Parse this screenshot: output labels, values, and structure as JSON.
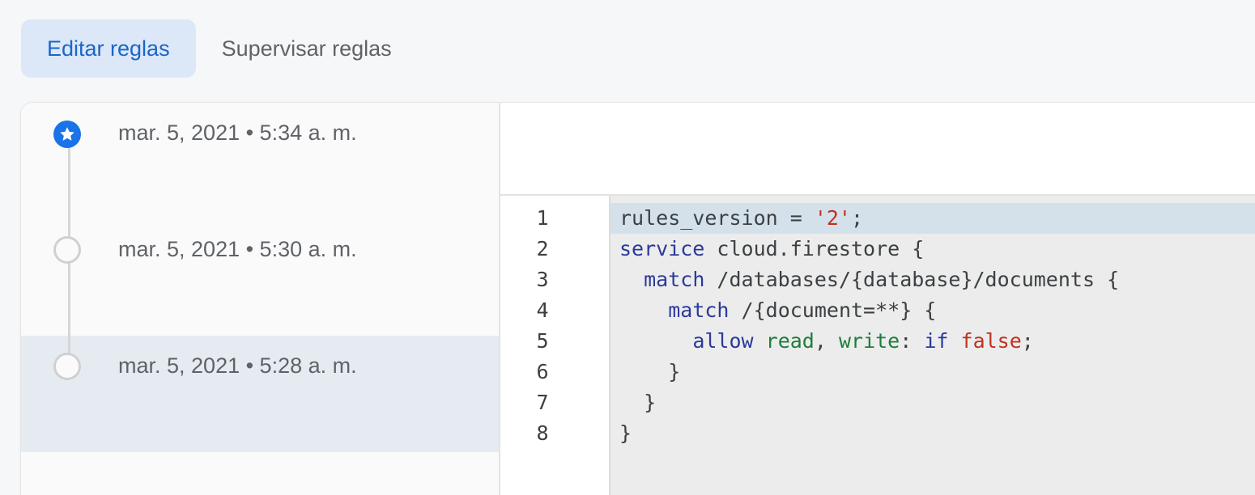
{
  "tabs": [
    {
      "label": "Editar reglas",
      "active": true
    },
    {
      "label": "Supervisar reglas",
      "active": false
    }
  ],
  "history": {
    "items": [
      {
        "timestamp": "mar. 5, 2021 • 5:34 a. m.",
        "status": "published",
        "selected": false
      },
      {
        "timestamp": "mar. 5, 2021 • 5:30 a. m.",
        "status": "previous",
        "selected": false
      },
      {
        "timestamp": "mar. 5, 2021 • 5:28 a. m.",
        "status": "previous",
        "selected": true
      }
    ]
  },
  "editor": {
    "line_numbers": [
      "1",
      "2",
      "3",
      "4",
      "5",
      "6",
      "7",
      "8"
    ],
    "current_line": 1,
    "lines": [
      [
        {
          "t": "rules_version = ",
          "c": "plain"
        },
        {
          "t": "'2'",
          "c": "str"
        },
        {
          "t": ";",
          "c": "plain"
        }
      ],
      [
        {
          "t": "service",
          "c": "kw"
        },
        {
          "t": " cloud.firestore {",
          "c": "plain"
        }
      ],
      [
        {
          "t": "  ",
          "c": "plain"
        },
        {
          "t": "match",
          "c": "kw"
        },
        {
          "t": " /databases/{database}/documents {",
          "c": "plain"
        }
      ],
      [
        {
          "t": "    ",
          "c": "plain"
        },
        {
          "t": "match",
          "c": "kw"
        },
        {
          "t": " /{document=**} {",
          "c": "plain"
        }
      ],
      [
        {
          "t": "      ",
          "c": "plain"
        },
        {
          "t": "allow",
          "c": "kw"
        },
        {
          "t": " ",
          "c": "plain"
        },
        {
          "t": "read",
          "c": "perm"
        },
        {
          "t": ", ",
          "c": "plain"
        },
        {
          "t": "write",
          "c": "perm"
        },
        {
          "t": ": ",
          "c": "plain"
        },
        {
          "t": "if",
          "c": "kw"
        },
        {
          "t": " ",
          "c": "plain"
        },
        {
          "t": "false",
          "c": "bool"
        },
        {
          "t": ";",
          "c": "plain"
        }
      ],
      [
        {
          "t": "    }",
          "c": "plain"
        }
      ],
      [
        {
          "t": "  }",
          "c": "plain"
        }
      ],
      [
        {
          "t": "}",
          "c": "plain"
        }
      ]
    ]
  },
  "colors": {
    "accent": "#1a73e8",
    "active_tab_bg": "#dce7f7",
    "active_tab_text": "#1a66c9",
    "keyword": "#2b3a99",
    "string": "#c0311f",
    "permission": "#1f7d3a",
    "current_line_bg": "#d5e1ea",
    "selected_history_bg": "#e6eaf1"
  },
  "icons": {
    "published": "star-icon"
  }
}
